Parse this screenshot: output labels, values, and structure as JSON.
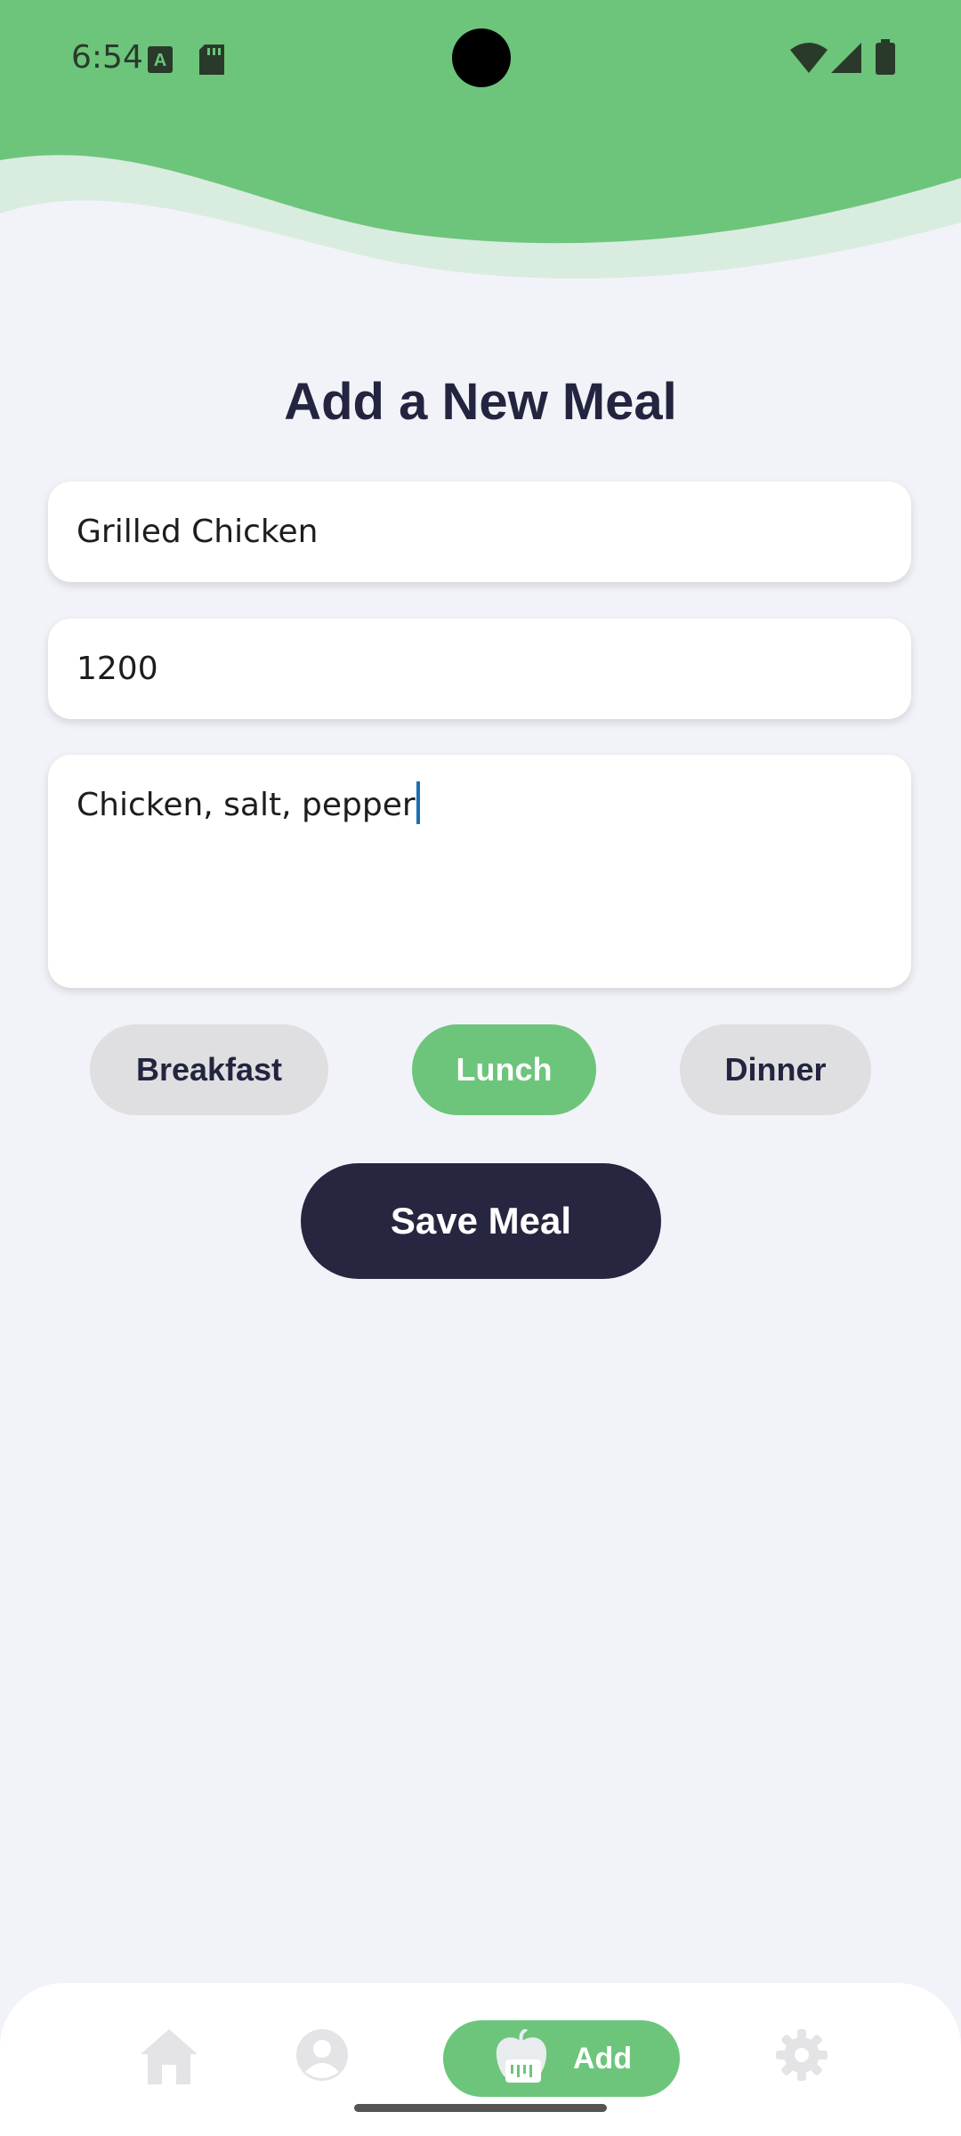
{
  "status_bar": {
    "time": "6:54"
  },
  "form": {
    "title": "Add a New Meal",
    "meal_name": "Grilled Chicken",
    "calories": "1200",
    "ingredients": "Chicken, salt, pepper"
  },
  "meal_types": [
    {
      "label": "Breakfast",
      "selected": false
    },
    {
      "label": "Lunch",
      "selected": true
    },
    {
      "label": "Dinner",
      "selected": false
    }
  ],
  "save_button": {
    "label": "Save Meal"
  },
  "bottom_nav": {
    "items": [
      {
        "icon": "home-icon"
      },
      {
        "icon": "profile-icon"
      },
      {
        "icon": "apple-scale-icon",
        "label": "Add",
        "active": true
      },
      {
        "icon": "gear-icon"
      }
    ]
  },
  "colors": {
    "accent_green": "#6cc57b",
    "wave_light": "#d9ece0",
    "dark_navy": "#262640",
    "background": "#f2f3f8"
  }
}
